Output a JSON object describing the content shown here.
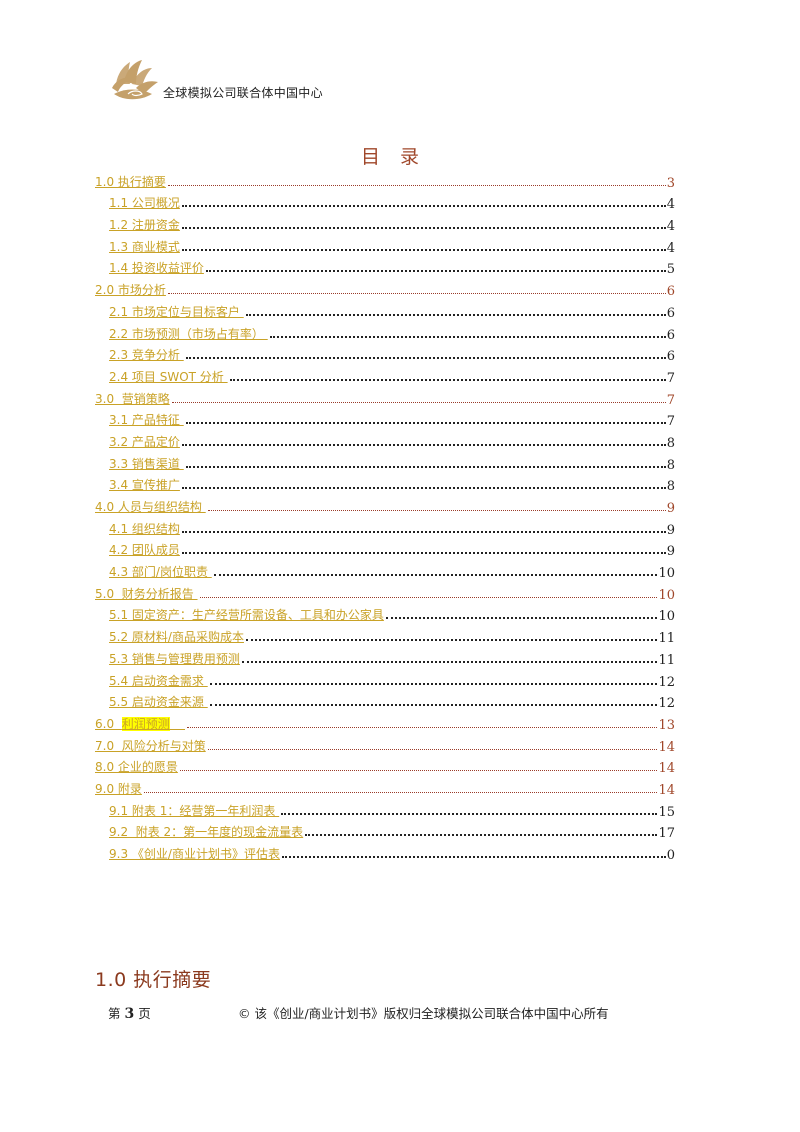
{
  "header": {
    "logo_icon": "lotus-logo-icon",
    "org_name": "全球模拟公司联合体中国中心"
  },
  "toc": {
    "title": "目录",
    "colors": {
      "link": "#c9a227",
      "level1_page": "#a0472a",
      "highlight": "#ffff00"
    },
    "entries": [
      {
        "level": 1,
        "label": "1.0 执行摘要",
        "page": "3"
      },
      {
        "level": 2,
        "label": "1.1 公司概况",
        "page": "4"
      },
      {
        "level": 2,
        "label": "1.2 注册资金",
        "page": "4"
      },
      {
        "level": 2,
        "label": "1.3 商业模式",
        "page": "4"
      },
      {
        "level": 2,
        "label": "1.4 投资收益评价",
        "page": "5"
      },
      {
        "level": 1,
        "label": "2.0 市场分析",
        "page": "6"
      },
      {
        "level": 2,
        "label": "2.1 市场定位与目标客户 ",
        "page": "6"
      },
      {
        "level": 2,
        "label": "2.2 市场预测（市场占有率） ",
        "page": "6"
      },
      {
        "level": 2,
        "label": "2.3 竞争分析 ",
        "page": "6"
      },
      {
        "level": 2,
        "label": "2.4 项目 SWOT 分析 ",
        "page": "7"
      },
      {
        "level": 1,
        "label": "3.0  营销策略",
        "page": "7"
      },
      {
        "level": 2,
        "label": "3.1 产品特征 ",
        "page": "7"
      },
      {
        "level": 2,
        "label": "3.2 产品定价",
        "page": "8"
      },
      {
        "level": 2,
        "label": "3.3 销售渠道 ",
        "page": "8"
      },
      {
        "level": 2,
        "label": "3.4 宣传推广",
        "page": "8"
      },
      {
        "level": 1,
        "label": "4.0 人员与组织结构 ",
        "page": "9"
      },
      {
        "level": 2,
        "label": "4.1 组织结构",
        "page": "9"
      },
      {
        "level": 2,
        "label": "4.2 团队成员",
        "page": "9"
      },
      {
        "level": 2,
        "label": "4.3 部门/岗位职责 ",
        "page": "10"
      },
      {
        "level": 1,
        "label": "5.0  财务分析报告 ",
        "page": "10"
      },
      {
        "level": 2,
        "label": "5.1 固定资产：生产经营所需设备、工具和办公家具",
        "page": "10"
      },
      {
        "level": 2,
        "label": "5.2 原材料/商品采购成本",
        "page": "11"
      },
      {
        "level": 2,
        "label": "5.3 销售与管理费用预测",
        "page": "11"
      },
      {
        "level": 2,
        "label": "5.4 启动资金需求 ",
        "page": "12"
      },
      {
        "level": 2,
        "label": "5.5 启动资金来源 ",
        "page": "12"
      },
      {
        "level": 1,
        "label_prefix": "6.0  ",
        "label_highlight": "利润预测",
        "label_suffix": "    ",
        "page": "13"
      },
      {
        "level": 1,
        "label": "7.0  风险分析与对策",
        "page": "14"
      },
      {
        "level": 1,
        "label": "8.0 企业的愿景",
        "page": "14"
      },
      {
        "level": 1,
        "label": "9.0 附录",
        "page": "14"
      },
      {
        "level": 2,
        "label": "9.1 附表 1：经营第一年利润表 ",
        "page": "15"
      },
      {
        "level": 2,
        "label": "9.2  附表 2：第一年度的现金流量表",
        "page": "17"
      },
      {
        "level": 2,
        "label": "9.3 《创业/商业计划书》评估表",
        "page": "0"
      }
    ]
  },
  "section_heading": "1.0 执行摘要",
  "footer": {
    "page_prefix": "第 ",
    "page_number": "3",
    "page_suffix": " 页",
    "copyright": "© 该《创业/商业计划书》版权归全球模拟公司联合体中国中心所有"
  }
}
